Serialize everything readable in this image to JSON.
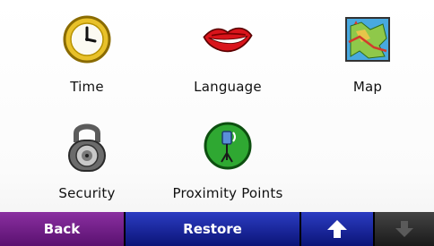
{
  "menu": {
    "items": [
      {
        "id": "time",
        "label": "Time",
        "icon": "clock-icon"
      },
      {
        "id": "language",
        "label": "Language",
        "icon": "lips-icon"
      },
      {
        "id": "map",
        "label": "Map",
        "icon": "map-icon"
      },
      {
        "id": "security",
        "label": "Security",
        "icon": "padlock-icon"
      },
      {
        "id": "proximity",
        "label": "Proximity Points",
        "icon": "proximity-alert-icon"
      }
    ]
  },
  "toolbar": {
    "back_label": "Back",
    "restore_label": "Restore",
    "up_icon": "arrow-up-icon",
    "down_icon": "arrow-down-icon"
  },
  "colors": {
    "back_button": "#6d1f86",
    "restore_button": "#1a26a0",
    "disabled_button": "#2b2b2b"
  }
}
